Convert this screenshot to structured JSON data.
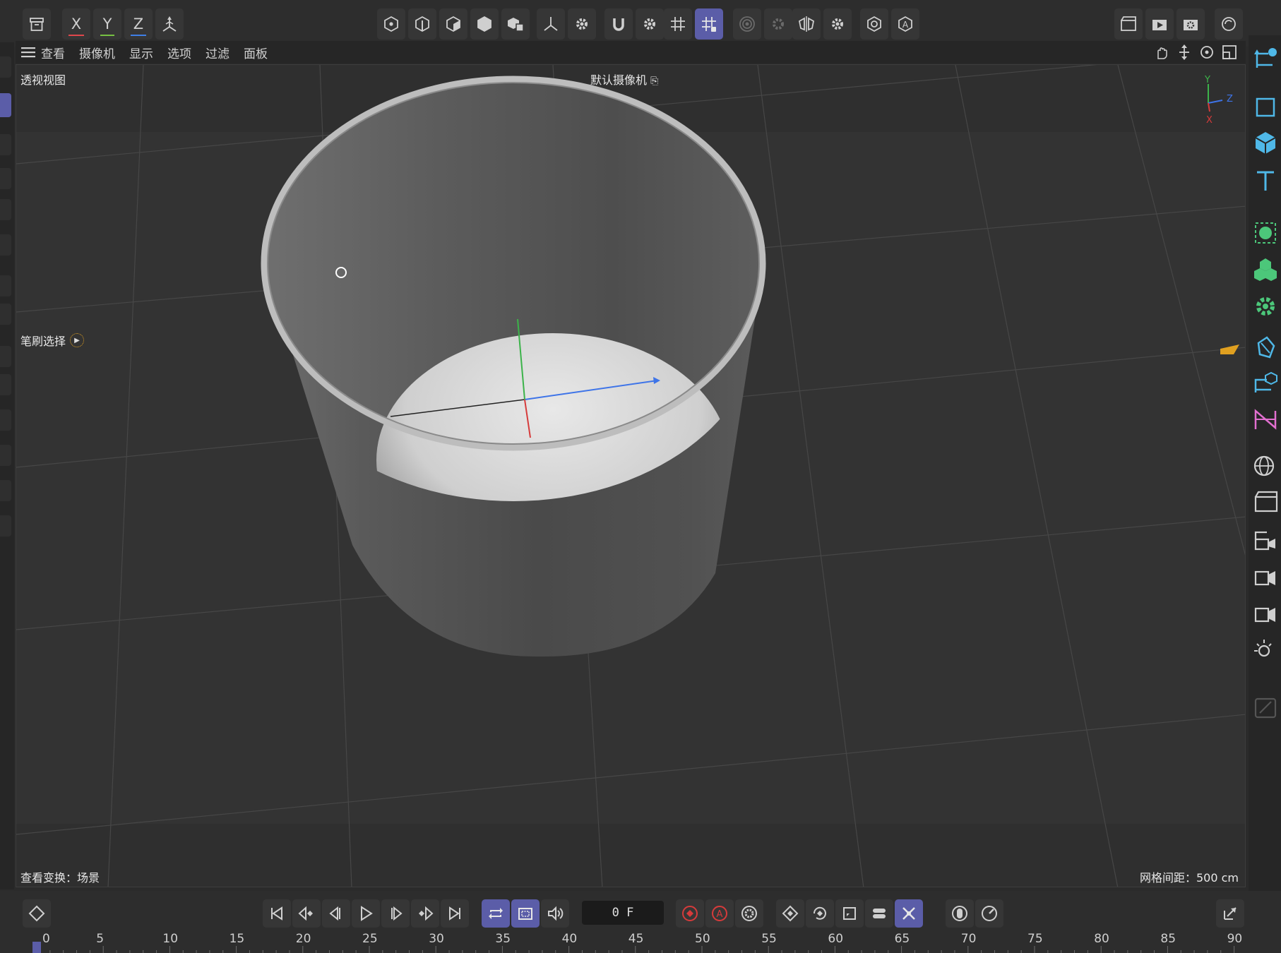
{
  "viewport_menu": [
    "查看",
    "摄像机",
    "显示",
    "选项",
    "过滤",
    "面板"
  ],
  "viewport": {
    "view_name": "透视视图",
    "camera_name": "默认摄像机",
    "tool_hint": "笔刷选择",
    "status_left": "查看变换：场景",
    "status_right": "网格间距：500 cm"
  },
  "axis_buttons": [
    {
      "label": "X",
      "color": "#e0474c"
    },
    {
      "label": "Y",
      "color": "#76c043"
    },
    {
      "label": "Z",
      "color": "#3f7fe6"
    }
  ],
  "gizmo_labels": {
    "y": "Y",
    "z": "Z",
    "x": "X"
  },
  "colors": {
    "accent": "#5b5da8",
    "axis_x": "#d63b3b",
    "axis_y": "#3cb34a",
    "axis_z": "#3e74e8",
    "palette_blue": "#4fb8e8",
    "palette_green": "#4cc77a",
    "palette_pink": "#e26fd0",
    "keyframe_orange": "#e0a020"
  },
  "timeline": {
    "current_frame": "0 F",
    "ticks": [
      "0",
      "5",
      "10",
      "15",
      "20",
      "25",
      "30",
      "35",
      "40",
      "45",
      "50",
      "55",
      "60",
      "65",
      "70",
      "75",
      "80",
      "85",
      "90"
    ]
  },
  "icons": {
    "top_left": [
      "archive-icon",
      "world-axis-icon"
    ],
    "top_mid": [
      "points-mode-icon",
      "edges-mode-icon",
      "polygons-mode-icon",
      "object-mode-icon",
      "texture-mode-icon",
      "axis-mode-icon",
      "settings-icon",
      "magnet-icon",
      "grid-snap-icon",
      "workplane-snap-icon",
      "soft-selection-icon",
      "symmetry-icon",
      "render-view-icon",
      "auto-icon"
    ],
    "top_right": [
      "render-region-icon",
      "render-view-icon",
      "render-settings-icon",
      "undo-view-icon"
    ]
  }
}
